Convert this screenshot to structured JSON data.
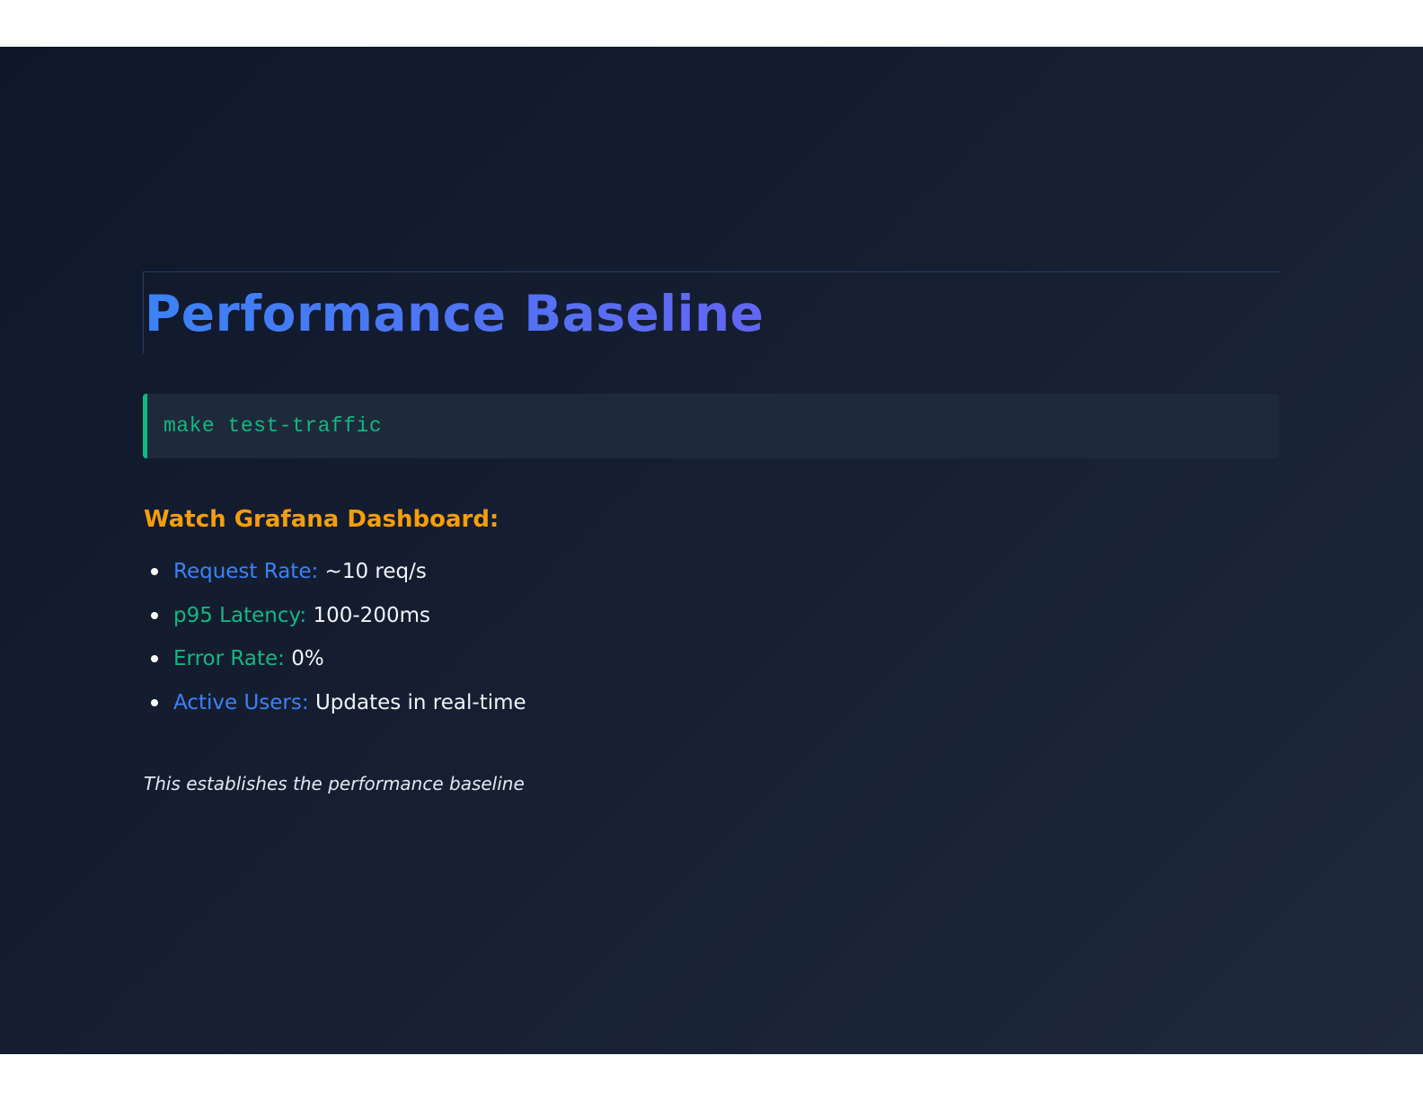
{
  "slide": {
    "title": "Performance Baseline",
    "command": "make test-traffic",
    "section_heading": "Watch Grafana Dashboard:",
    "metrics": [
      {
        "label": "Request Rate:",
        "value": "~10 req/s",
        "label_color": "#3b82f6"
      },
      {
        "label": "p95 Latency:",
        "value": "100-200ms",
        "label_color": "#10b981"
      },
      {
        "label": "Error Rate:",
        "value": "0%",
        "label_color": "#10b981"
      },
      {
        "label": "Active Users:",
        "value": "Updates in real-time",
        "label_color": "#3b82f6"
      }
    ],
    "footnote": "This establishes the performance baseline"
  },
  "colors": {
    "title_gradient_start": "#3b82f6",
    "title_gradient_end": "#6366f1",
    "code_accent": "#10b981",
    "heading_accent": "#f59e0b",
    "background": "#0f172a"
  }
}
